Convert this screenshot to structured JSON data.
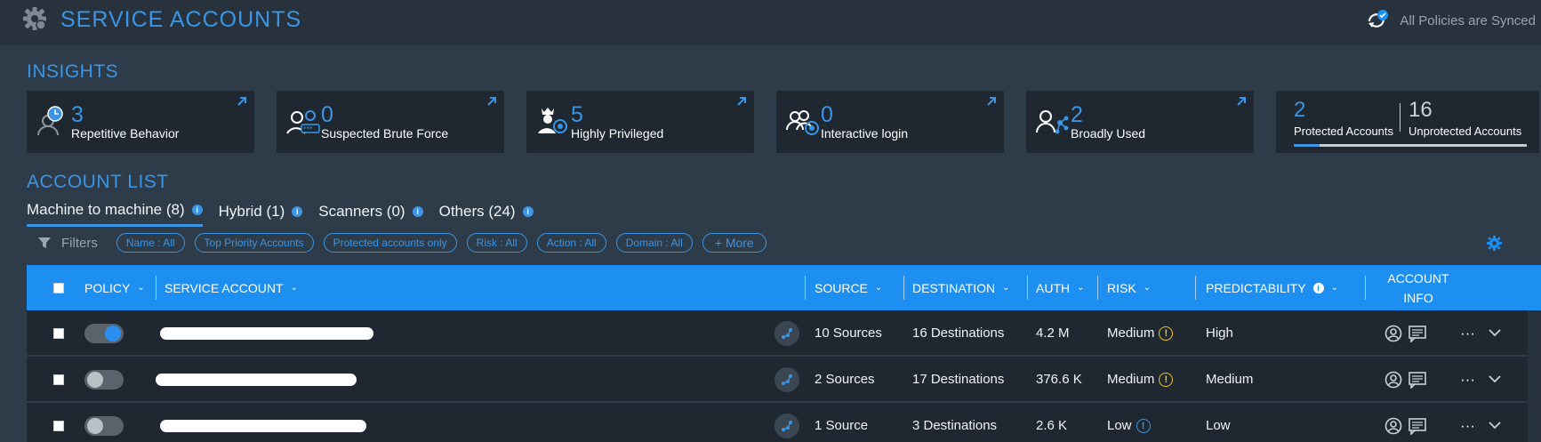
{
  "header": {
    "title": "SERVICE ACCOUNTS",
    "sync_status": "All Policies are Synced"
  },
  "insights": {
    "title": "INSIGHTS",
    "cards": [
      {
        "value": "3",
        "label": "Repetitive Behavior"
      },
      {
        "value": "0",
        "label": "Suspected Brute Force"
      },
      {
        "value": "5",
        "label": "Highly Privileged"
      },
      {
        "value": "0",
        "label": "Interactive login"
      },
      {
        "value": "2",
        "label": "Broadly Used"
      }
    ],
    "protection": {
      "protected_value": "2",
      "protected_label": "Protected Accounts",
      "unprotected_value": "16",
      "unprotected_label": "Unprotected Accounts",
      "protected_fraction": 0.11
    }
  },
  "account_list": {
    "title": "ACCOUNT LIST",
    "tabs": [
      {
        "label": "Machine to machine (8)"
      },
      {
        "label": "Hybrid (1)"
      },
      {
        "label": "Scanners (0)"
      },
      {
        "label": "Others (24)"
      }
    ],
    "filters": {
      "label": "Filters",
      "chips": [
        "Name : All",
        "Top Priority Accounts",
        "Protected accounts only",
        "Risk : All",
        "Action : All",
        "Domain : All"
      ],
      "more": "+ More"
    },
    "columns": {
      "policy": "POLICY",
      "service_account": "SERVICE ACCOUNT",
      "source": "SOURCE",
      "destination": "DESTINATION",
      "auth": "AUTH",
      "risk": "RISK",
      "predictability": "PREDICTABILITY",
      "account_info_1": "ACCOUNT",
      "account_info_2": "INFO"
    },
    "rows": [
      {
        "policy_on": true,
        "source": "10 Sources",
        "destination": "16 Destinations",
        "auth": "4.2 M",
        "risk": "Medium",
        "risk_symbol": "!",
        "predictability": "High"
      },
      {
        "policy_on": false,
        "source": "2 Sources",
        "destination": "17 Destinations",
        "auth": "376.6 K",
        "risk": "Medium",
        "risk_symbol": "!",
        "predictability": "Medium"
      },
      {
        "policy_on": false,
        "source": "1 Source",
        "destination": "3 Destinations",
        "auth": "2.6 K",
        "risk": "Low",
        "risk_symbol": "!",
        "predictability": "Low"
      }
    ],
    "row_more": "···"
  },
  "colors": {
    "accent": "#3a95e6",
    "header_bar": "#1d8ff0",
    "warning": "#f5c518"
  }
}
